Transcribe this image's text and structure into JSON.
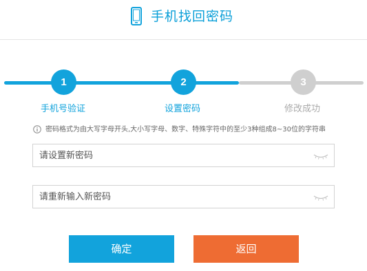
{
  "header": {
    "title": "手机找回密码",
    "icon": "phone-icon"
  },
  "steps": [
    {
      "number": "1",
      "label": "手机号验证",
      "state": "active"
    },
    {
      "number": "2",
      "label": "设置密码",
      "state": "active"
    },
    {
      "number": "3",
      "label": "修改成功",
      "state": "inactive"
    }
  ],
  "hint": {
    "icon": "info-icon",
    "text": "密码格式为由大写字母开头,大小写字母、数字、特殊字符中的至少3种组成8~30位的字符串"
  },
  "form": {
    "new_password_placeholder": "请设置新密码",
    "confirm_password_placeholder": "请重新输入新密码",
    "toggle_icon": "eye-closed-icon"
  },
  "buttons": {
    "confirm_label": "确定",
    "back_label": "返回"
  },
  "colors": {
    "accent": "#12a3dc",
    "inactive": "#cfcfcf",
    "back_button": "#ee6c33"
  }
}
